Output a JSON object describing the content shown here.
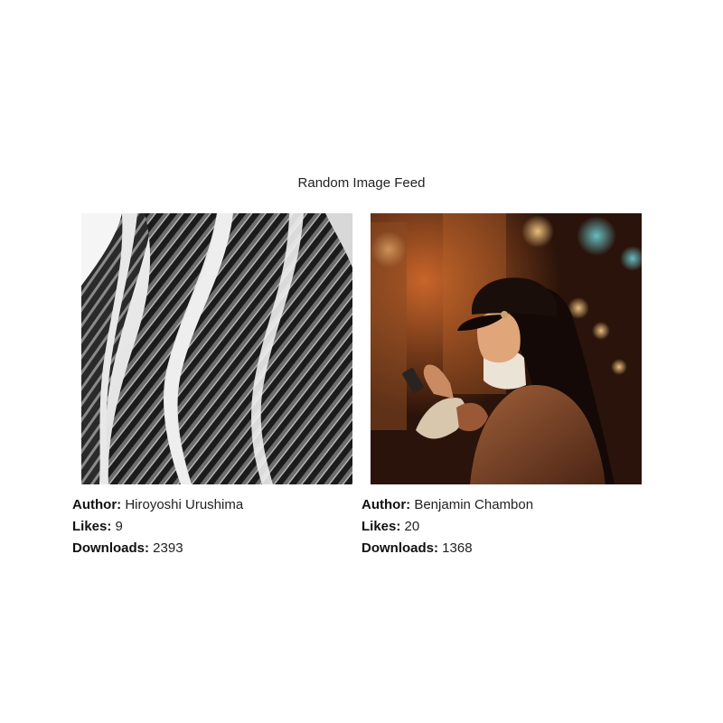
{
  "feed": {
    "title": "Random Image Feed"
  },
  "labels": {
    "author": "Author:",
    "likes": "Likes:",
    "downloads": "Downloads:"
  },
  "cards": [
    {
      "image": "bw-architecture-photo",
      "author": "Hiroyoshi Urushima",
      "likes": "9",
      "downloads": "2393"
    },
    {
      "image": "night-phone-portrait-photo",
      "author": "Benjamin Chambon",
      "likes": "20",
      "downloads": "1368"
    }
  ]
}
